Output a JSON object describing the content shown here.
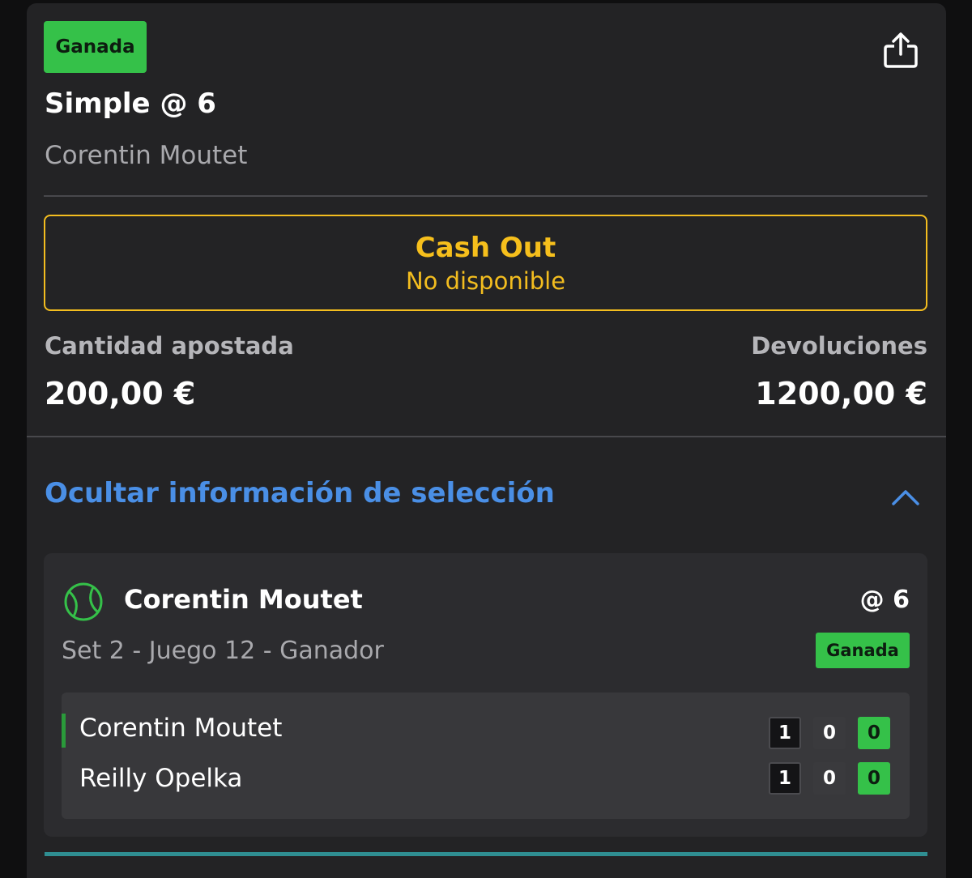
{
  "bet": {
    "status_label": "Ganada",
    "title": "Simple @ 6",
    "subtitle": "Corentin Moutet"
  },
  "cashout": {
    "title": "Cash Out",
    "subtitle": "No disponible"
  },
  "stake": {
    "label": "Cantidad apostada",
    "value": "200,00 €"
  },
  "returns": {
    "label": "Devoluciones",
    "value": "1200,00 €"
  },
  "selection_toggle": {
    "label": "Ocultar información de selección"
  },
  "selection": {
    "sport_icon": "tennis-ball-icon",
    "name": "Corentin Moutet",
    "odds": "@ 6",
    "market": "Set 2 - Juego 12 - Ganador",
    "status_label": "Ganada",
    "players": [
      {
        "name": "Corentin Moutet",
        "sets": "1",
        "games": "0",
        "points": "0",
        "serving": true
      },
      {
        "name": "Reilly Opelka",
        "sets": "1",
        "games": "0",
        "points": "0",
        "serving": false
      }
    ]
  },
  "icons": {
    "share": "share-icon",
    "collapse": "chevron-up-icon"
  },
  "colors": {
    "win_green": "#35c149",
    "cashout_yellow": "#f3bd1f",
    "link_blue": "#4a8fe6",
    "card_bg": "#232325"
  }
}
